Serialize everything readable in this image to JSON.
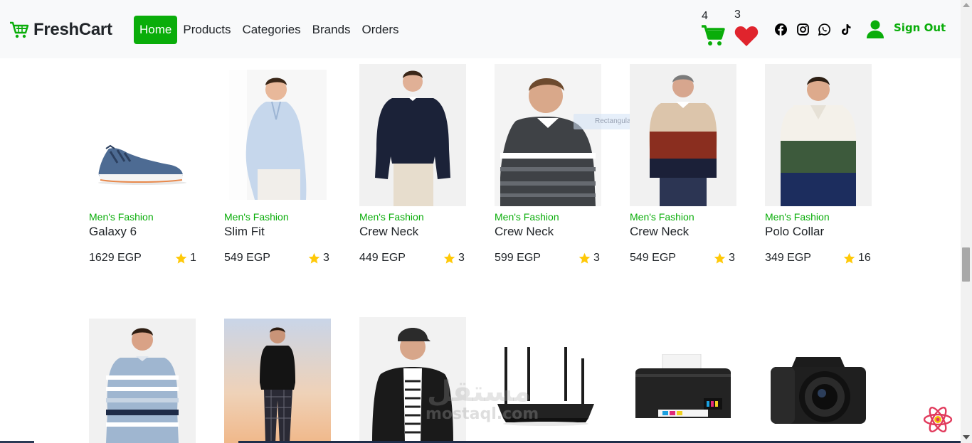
{
  "brand": {
    "name": "FreshCart"
  },
  "nav": {
    "links": [
      "Home",
      "Products",
      "Categories",
      "Brands",
      "Orders"
    ],
    "active": "Home"
  },
  "cart": {
    "count": "4",
    "icon": "cart-icon"
  },
  "wishlist": {
    "count": "3",
    "icon": "heart-icon"
  },
  "social": [
    "facebook-icon",
    "instagram-icon",
    "whatsapp-icon",
    "tiktok-icon"
  ],
  "user": {
    "signout_label": "Sign Out",
    "icon": "user-icon"
  },
  "colors": {
    "accent": "#0aad0a",
    "heart": "#e0242d",
    "star": "#ffc908"
  },
  "products_row1": [
    {
      "category": "Men's Fashion",
      "name": "Galaxy 6",
      "price": "1629 EGP",
      "rating": "1"
    },
    {
      "category": "Men's Fashion",
      "name": "Slim Fit",
      "price": "549 EGP",
      "rating": "3"
    },
    {
      "category": "Men's Fashion",
      "name": "Crew Neck",
      "price": "449 EGP",
      "rating": "3"
    },
    {
      "category": "Men's Fashion",
      "name": "Crew Neck",
      "price": "599 EGP",
      "rating": "3"
    },
    {
      "category": "Men's Fashion",
      "name": "Crew Neck",
      "price": "549 EGP",
      "rating": "3"
    },
    {
      "category": "Men's Fashion",
      "name": "Polo Collar",
      "price": "349 EGP",
      "rating": "16"
    }
  ],
  "tooltip_ghost": "Rectangular Snip",
  "watermark": {
    "line1": "مستقل",
    "line2": "mostaql.com"
  }
}
